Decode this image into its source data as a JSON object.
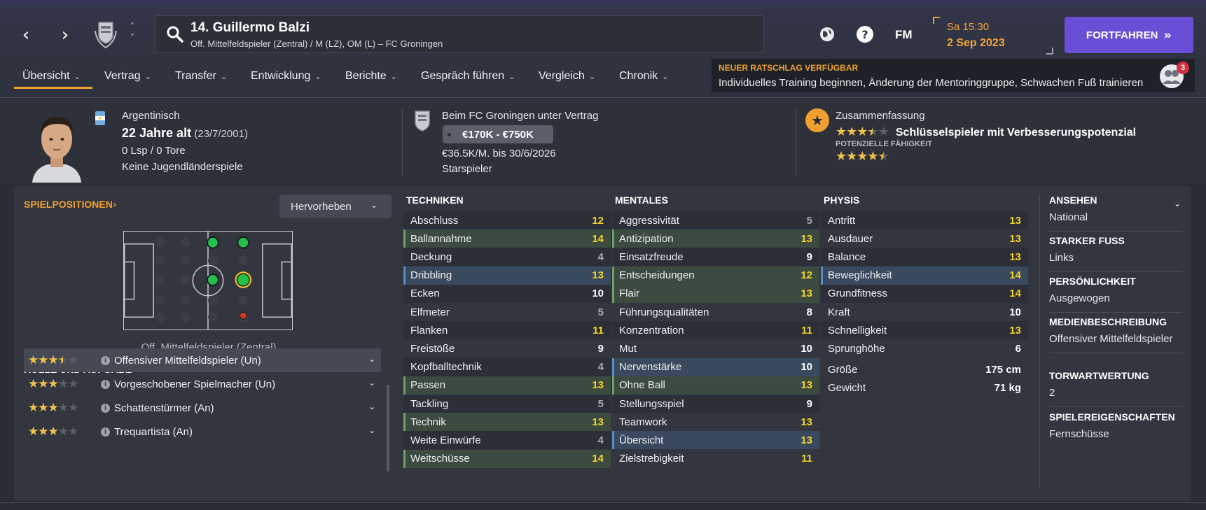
{
  "header": {
    "player_name": "14. Guillermo Balzi",
    "player_subtitle": "Off. Mittelfeldspieler (Zentral) / M (LZ), OM (L) – FC Groningen",
    "fm_label": "FM",
    "date_time": "Sa 15:30",
    "date_day": "2 Sep 2023",
    "continue_label": "FORTFAHREN",
    "icons": [
      "back-arrow-icon",
      "forward-arrow-icon",
      "club-crest-icon",
      "search-icon",
      "globe-icon",
      "help-icon"
    ]
  },
  "tabs": [
    {
      "label": "Übersicht"
    },
    {
      "label": "Vertrag"
    },
    {
      "label": "Transfer"
    },
    {
      "label": "Entwicklung"
    },
    {
      "label": "Berichte"
    },
    {
      "label": "Gespräch führen"
    },
    {
      "label": "Vergleich"
    },
    {
      "label": "Chronik"
    }
  ],
  "advice": {
    "title": "NEUER RATSCHLAG VERFÜGBAR",
    "text": "Individuelles Training beginnen, Änderung der Mentoringgruppe, Schwachen Fuß trainieren",
    "badge": "3"
  },
  "info": {
    "nationality": "Argentinisch",
    "age": "22 Jahre alt",
    "birthdate": "(23/7/2001)",
    "caps": "0 Lsp / 0 Tore",
    "youth": "Keine Jugendländerspiele",
    "contract_title": "Beim FC Groningen unter Vertrag",
    "value": "€170K - €750K",
    "wage": "€36.5K/M. bis 30/6/2026",
    "status": "Starspieler",
    "summary_title": "Zusammenfassung",
    "summary_text": "Schlüsselspieler mit Verbesserungspotenzial",
    "summary_stars": 3.5,
    "potential_label": "POTENZIELLE FÄHIGKEIT",
    "potential_stars": 4.5
  },
  "positions": {
    "title": "SPIELPOSITIONEN",
    "highlight_button": "Hervorheben",
    "position_label": "Off. Mittelfeldspieler (Zentral)"
  },
  "roles": {
    "title": "ROLLE UND AUFGABE",
    "items": [
      {
        "name": "Offensiver Mittelfeldspieler (Un)",
        "stars": 3.5
      },
      {
        "name": "Vorgeschobener Spielmacher (Un)",
        "stars": 3
      },
      {
        "name": "Schattenstürmer (An)",
        "stars": 3
      },
      {
        "name": "Trequartista (An)",
        "stars": 3
      }
    ]
  },
  "attributes": {
    "technical": {
      "title": "TECHNIKEN",
      "rows": [
        {
          "name": "Abschluss",
          "value": "12",
          "hl": "",
          "color": "yellow"
        },
        {
          "name": "Ballannahme",
          "value": "14",
          "hl": "green",
          "color": "yellow"
        },
        {
          "name": "Deckung",
          "value": "4",
          "hl": "",
          "color": "grey"
        },
        {
          "name": "Dribbling",
          "value": "13",
          "hl": "blue",
          "color": "yellow"
        },
        {
          "name": "Ecken",
          "value": "10",
          "hl": "",
          "color": "white"
        },
        {
          "name": "Elfmeter",
          "value": "5",
          "hl": "",
          "color": "grey"
        },
        {
          "name": "Flanken",
          "value": "11",
          "hl": "",
          "color": "yellow"
        },
        {
          "name": "Freistöße",
          "value": "9",
          "hl": "",
          "color": "white"
        },
        {
          "name": "Kopfballtechnik",
          "value": "4",
          "hl": "",
          "color": "grey"
        },
        {
          "name": "Passen",
          "value": "13",
          "hl": "green",
          "color": "yellow"
        },
        {
          "name": "Tackling",
          "value": "5",
          "hl": "",
          "color": "grey"
        },
        {
          "name": "Technik",
          "value": "13",
          "hl": "green",
          "color": "yellow"
        },
        {
          "name": "Weite Einwürfe",
          "value": "4",
          "hl": "",
          "color": "grey"
        },
        {
          "name": "Weitschüsse",
          "value": "14",
          "hl": "green",
          "color": "yellow"
        }
      ]
    },
    "mental": {
      "title": "MENTALES",
      "rows": [
        {
          "name": "Aggressivität",
          "value": "5",
          "hl": "",
          "color": "grey"
        },
        {
          "name": "Antizipation",
          "value": "13",
          "hl": "green",
          "color": "yellow"
        },
        {
          "name": "Einsatzfreude",
          "value": "9",
          "hl": "",
          "color": "white"
        },
        {
          "name": "Entscheidungen",
          "value": "12",
          "hl": "green",
          "color": "yellow"
        },
        {
          "name": "Flair",
          "value": "13",
          "hl": "green",
          "color": "yellow"
        },
        {
          "name": "Führungsqualitäten",
          "value": "8",
          "hl": "",
          "color": "white"
        },
        {
          "name": "Konzentration",
          "value": "11",
          "hl": "",
          "color": "yellow"
        },
        {
          "name": "Mut",
          "value": "10",
          "hl": "",
          "color": "white"
        },
        {
          "name": "Nervenstärke",
          "value": "10",
          "hl": "blue",
          "color": "white"
        },
        {
          "name": "Ohne Ball",
          "value": "13",
          "hl": "green",
          "color": "yellow"
        },
        {
          "name": "Stellungsspiel",
          "value": "9",
          "hl": "",
          "color": "white"
        },
        {
          "name": "Teamwork",
          "value": "13",
          "hl": "",
          "color": "yellow"
        },
        {
          "name": "Übersicht",
          "value": "13",
          "hl": "blue",
          "color": "yellow"
        },
        {
          "name": "Zielstrebigkeit",
          "value": "11",
          "hl": "",
          "color": "yellow"
        }
      ]
    },
    "physical": {
      "title": "PHYSIS",
      "rows": [
        {
          "name": "Antritt",
          "value": "13",
          "hl": "",
          "color": "yellow"
        },
        {
          "name": "Ausdauer",
          "value": "13",
          "hl": "",
          "color": "yellow"
        },
        {
          "name": "Balance",
          "value": "13",
          "hl": "",
          "color": "yellow"
        },
        {
          "name": "Beweglichkeit",
          "value": "14",
          "hl": "blue",
          "color": "yellow"
        },
        {
          "name": "Grundfitness",
          "value": "14",
          "hl": "",
          "color": "yellow"
        },
        {
          "name": "Kraft",
          "value": "10",
          "hl": "",
          "color": "white"
        },
        {
          "name": "Schnelligkeit",
          "value": "13",
          "hl": "",
          "color": "yellow"
        },
        {
          "name": "Sprunghöhe",
          "value": "6",
          "hl": "",
          "color": "white"
        }
      ],
      "height_label": "Größe",
      "height_value": "175 cm",
      "weight_label": "Gewicht",
      "weight_value": "71 kg"
    }
  },
  "side": [
    {
      "title": "ANSEHEN",
      "value": "National"
    },
    {
      "title": "STARKER FUSS",
      "value": "Links"
    },
    {
      "title": "PERSÖNLICHKEIT",
      "value": "Ausgewogen"
    },
    {
      "title": "MEDIENBESCHREIBUNG",
      "value": "Offensiver Mittelfeldspieler"
    },
    {
      "title": "TORWARTWERTUNG",
      "value": "2"
    },
    {
      "title": "SPIELEREIGENSCHAFTEN",
      "value": "Fernschüsse"
    }
  ],
  "colors": {
    "accent_orange": "#f0a030",
    "continue_purple": "#6a4ed6",
    "value_yellow": "#f2d32a",
    "highlight_green": "#3d4a3f",
    "highlight_blue": "#3a4a5e"
  }
}
